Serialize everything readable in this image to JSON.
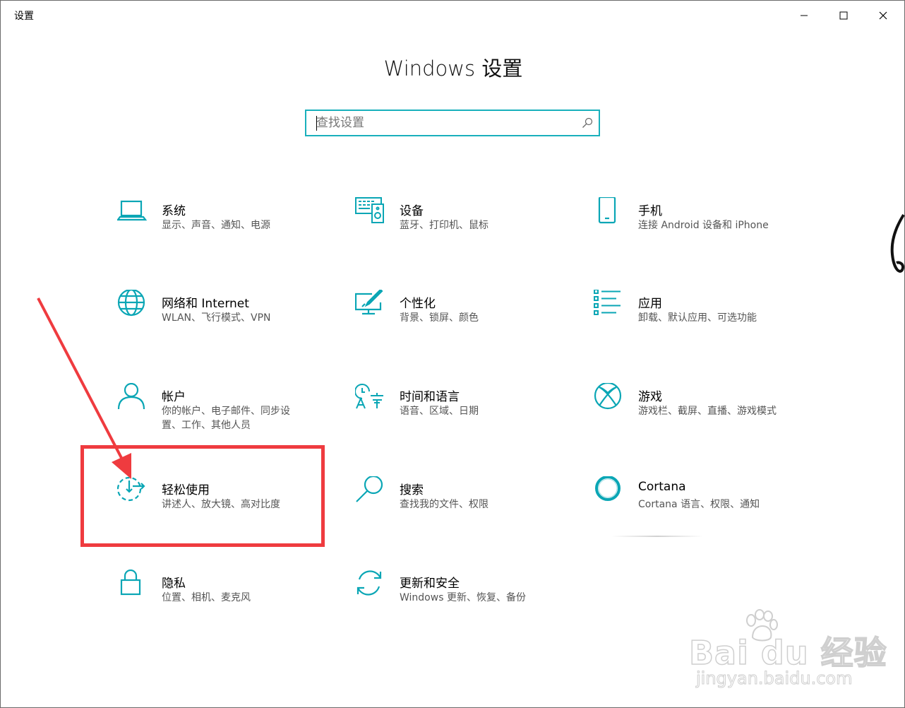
{
  "window": {
    "title": "设置",
    "controls": {
      "minimize": "minimize-icon",
      "maximize": "maximize-icon",
      "close": "close-icon"
    }
  },
  "page": {
    "heading": "Windows 设置"
  },
  "search": {
    "placeholder": "查找设置",
    "icon": "search-icon"
  },
  "accent_color": "#0aa6b5",
  "tiles": [
    {
      "name": "系统",
      "desc": "显示、声音、通知、电源",
      "icon": "laptop-icon"
    },
    {
      "name": "设备",
      "desc": "蓝牙、打印机、鼠标",
      "icon": "devices-icon"
    },
    {
      "name": "手机",
      "desc": "连接 Android 设备和 iPhone",
      "icon": "phone-icon"
    },
    {
      "name": "网络和 Internet",
      "desc": "WLAN、飞行模式、VPN",
      "icon": "globe-icon"
    },
    {
      "name": "个性化",
      "desc": "背景、锁屏、颜色",
      "icon": "personalization-icon"
    },
    {
      "name": "应用",
      "desc": "卸载、默认应用、可选功能",
      "icon": "apps-list-icon"
    },
    {
      "name": "帐户",
      "desc": "你的帐户、电子邮件、同步设置、工作、其他人员",
      "icon": "person-icon"
    },
    {
      "name": "时间和语言",
      "desc": "语音、区域、日期",
      "icon": "time-language-icon"
    },
    {
      "name": "游戏",
      "desc": "游戏栏、截屏、直播、游戏模式",
      "icon": "xbox-icon"
    },
    {
      "name": "轻松使用",
      "desc": "讲述人、放大镜、高对比度",
      "icon": "ease-of-access-icon"
    },
    {
      "name": "搜索",
      "desc": "查找我的文件、权限",
      "icon": "search-magnifier-icon"
    },
    {
      "name": "Cortana",
      "desc": "Cortana 语言、权限、通知",
      "icon": "cortana-ring-icon"
    },
    {
      "name": "隐私",
      "desc": "位置、相机、麦克风",
      "icon": "lock-icon"
    },
    {
      "name": "更新和安全",
      "desc": "Windows 更新、恢复、备份",
      "icon": "update-arrows-icon"
    }
  ],
  "annotation": {
    "highlight_color": "#ef3b3f",
    "arrow_color": "#ef3b3f"
  },
  "watermark": {
    "brand": "Bai du 经验",
    "url": "jingyan.baidu.com"
  }
}
